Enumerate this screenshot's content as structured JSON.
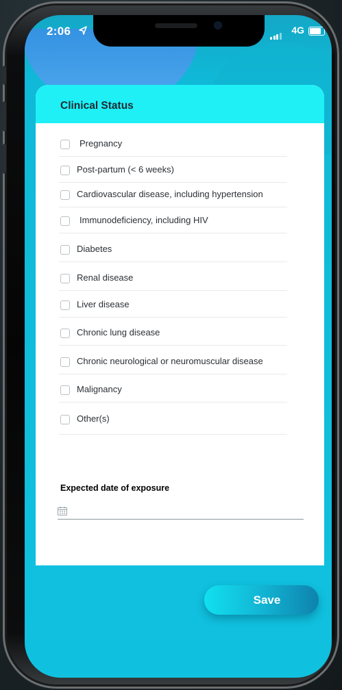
{
  "status_bar": {
    "time": "2:06",
    "network": "4G"
  },
  "card": {
    "title": "Clinical Status",
    "conditions": [
      {
        "label": "Pregnancy",
        "checked": false
      },
      {
        "label": "Post-partum (< 6 weeks)",
        "checked": false
      },
      {
        "label": "Cardiovascular disease, including hypertension",
        "checked": false
      },
      {
        "label": "Immunodeficiency, including HIV",
        "checked": false
      },
      {
        "label": "Diabetes",
        "checked": false
      },
      {
        "label": "Renal disease",
        "checked": false
      },
      {
        "label": "Liver disease",
        "checked": false
      },
      {
        "label": "Chronic lung disease",
        "checked": false
      },
      {
        "label": "Chronic neurological or neuromuscular disease",
        "checked": false
      },
      {
        "label": "Malignancy",
        "checked": false
      },
      {
        "label": "Other(s)",
        "checked": false
      }
    ],
    "date_field": {
      "label": "Expected date of exposure",
      "value": "",
      "icon": "calendar-icon"
    }
  },
  "actions": {
    "save_label": "Save"
  },
  "colors": {
    "header_accent": "#1ff0f6",
    "background": "#10c1df",
    "save_gradient_start": "#11e0f0",
    "save_gradient_end": "#0e82ad"
  }
}
